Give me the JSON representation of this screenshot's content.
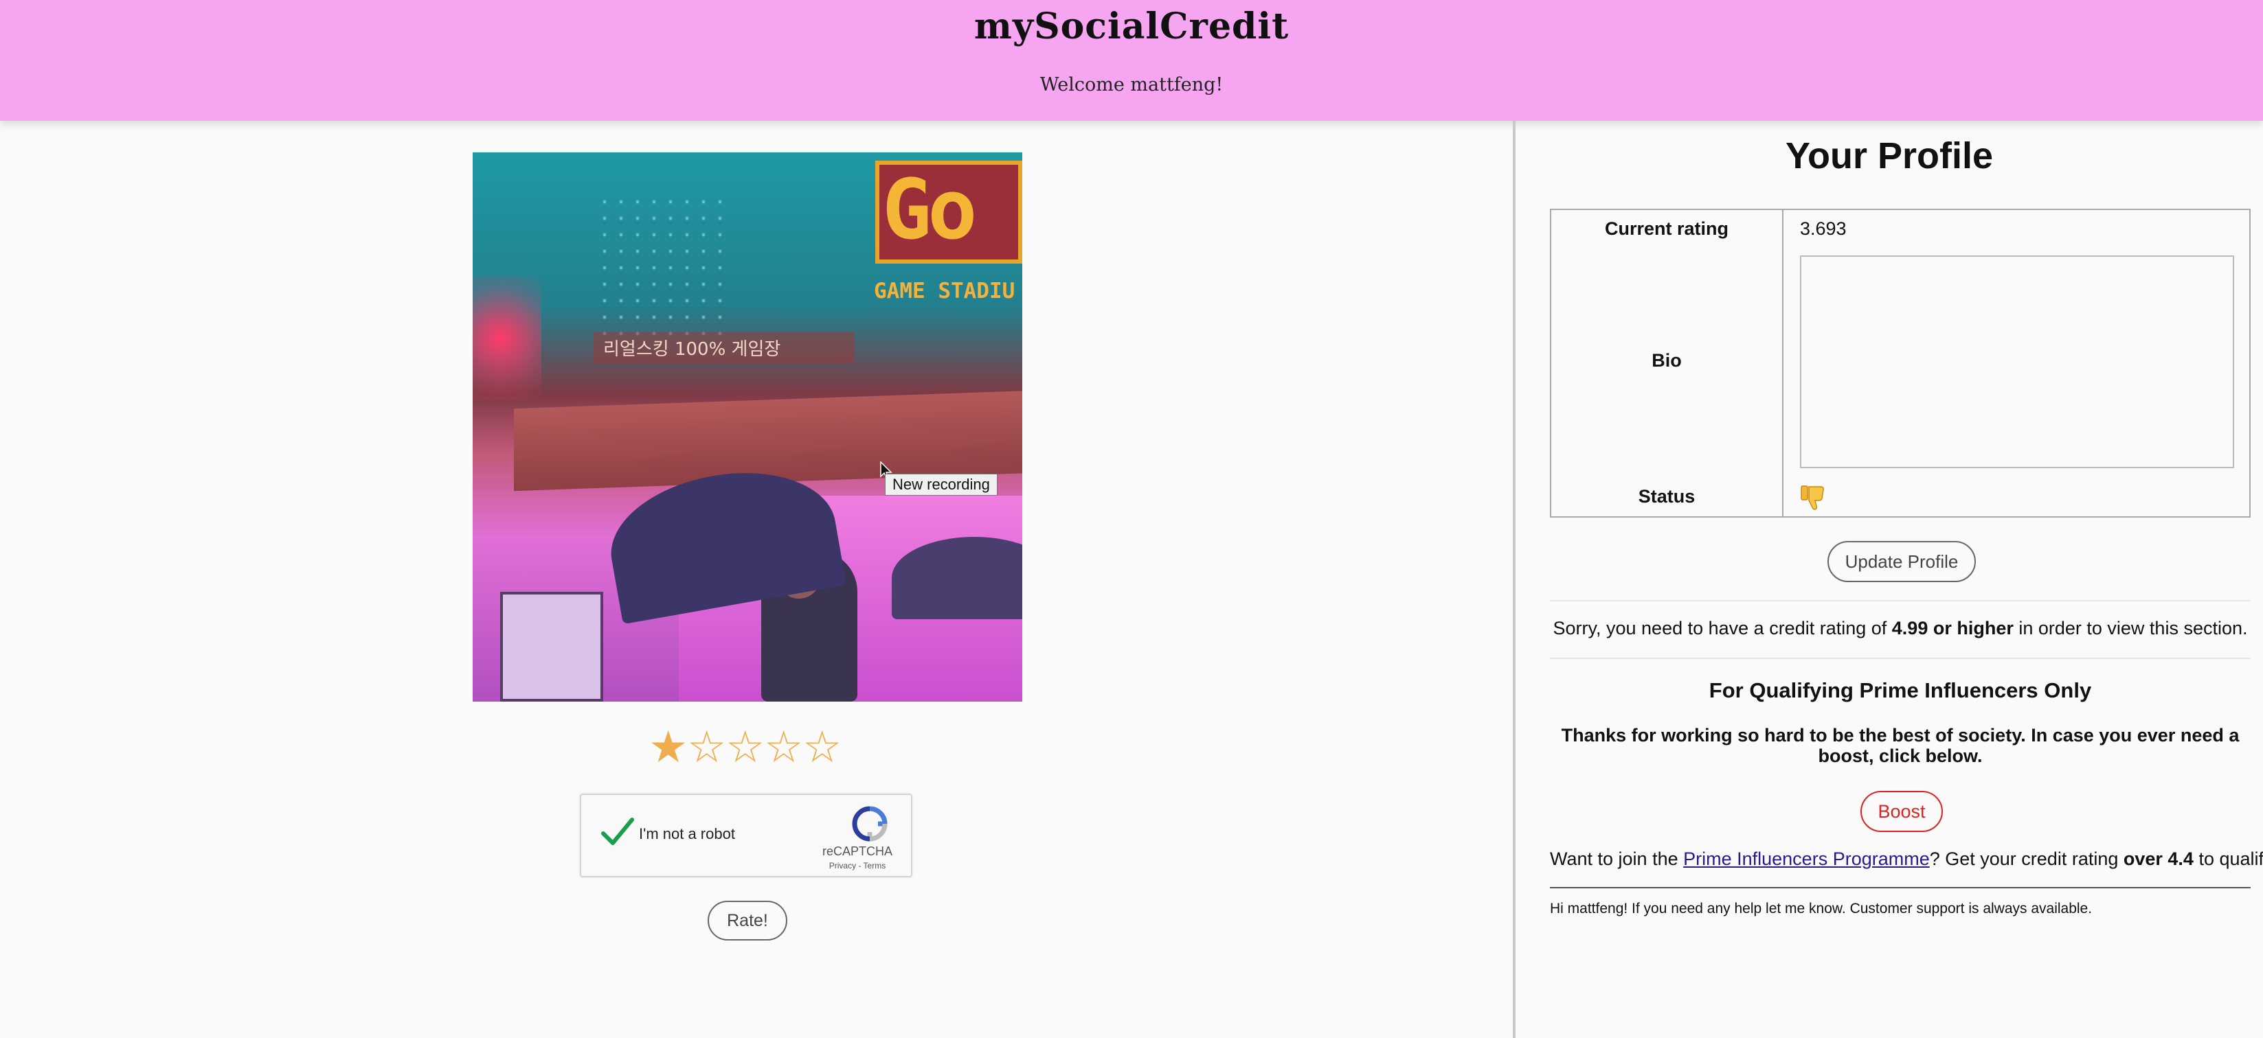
{
  "header": {
    "app_title": "mySocialCredit",
    "welcome": "Welcome mattfeng!"
  },
  "post": {
    "image": {
      "sign_letters": "Go",
      "sign_text": "GAME STADIU",
      "korean_text": "리얼스킹 100% 게임장"
    },
    "tooltip": "New recording",
    "rating_stars": {
      "filled": 1,
      "total": 5
    },
    "recaptcha": {
      "checked": true,
      "label": "I'm not a robot",
      "brand": "reCAPTCHA",
      "links": "Privacy - Terms"
    },
    "rate_button": "Rate!"
  },
  "profile": {
    "title": "Your Profile",
    "current_rating_label": "Current rating",
    "current_rating_value": "3.693",
    "bio_label": "Bio",
    "bio_value": "",
    "status_label": "Status",
    "status_icon": "thumbs-down-icon",
    "update_button": "Update Profile"
  },
  "restricted": {
    "sorry_prefix": "Sorry, you need to have a credit rating of ",
    "sorry_bold": "4.99 or higher",
    "sorry_suffix": " in order to view this section."
  },
  "prime": {
    "title": "For Qualifying Prime Influencers Only",
    "thanks": "Thanks for working so hard to be the best of society. In case you ever need a boost, click below.",
    "boost_button": "Boost",
    "join_prefix": "Want to join the ",
    "join_link": "Prime Influencers Programme",
    "join_middle": "? Get your credit rating ",
    "join_bold": "over 4.4",
    "join_suffix": " to qualify."
  },
  "support": {
    "message": "Hi mattfeng! If you need any help let me know. Customer support is always available."
  },
  "colors": {
    "header_bg": "#f6a5f1",
    "star": "#f0ad4e",
    "boost": "#dd2222",
    "link": "#2b1a8a"
  }
}
